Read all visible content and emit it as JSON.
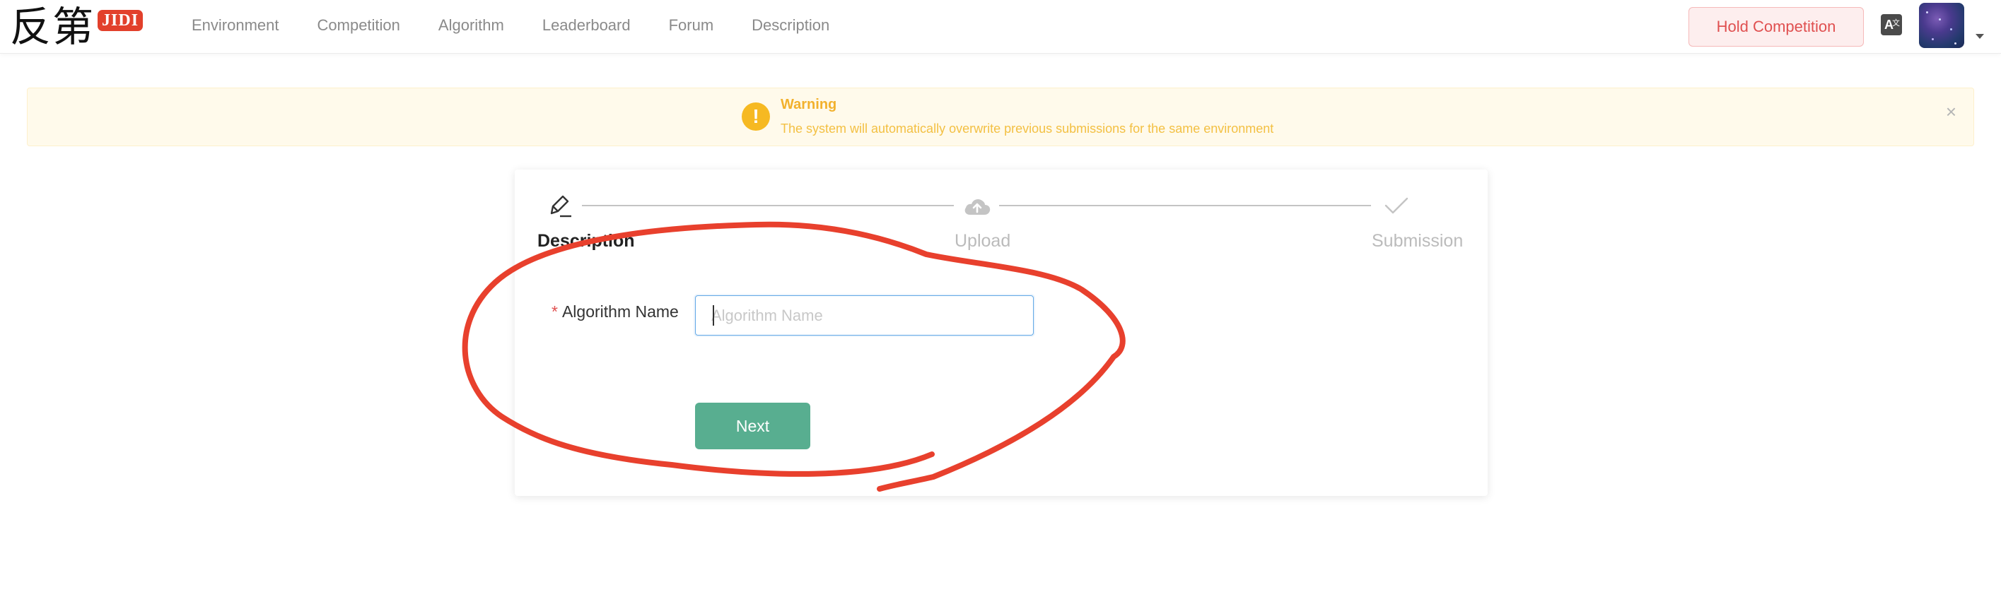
{
  "header": {
    "logo_cn": "反第",
    "logo_badge": "JIDI",
    "nav": [
      "Environment",
      "Competition",
      "Algorithm",
      "Leaderboard",
      "Forum",
      "Description"
    ],
    "hold_button": "Hold Competition",
    "lang_icon_glyph": "A",
    "lang_icon_small": "文"
  },
  "warning": {
    "title": "Warning",
    "text": "The system will automatically overwrite previous submissions for the same environment",
    "close_glyph": "×",
    "icon_glyph": "!"
  },
  "steps": [
    {
      "label": "Description",
      "icon": "pencil-icon",
      "status": "active"
    },
    {
      "label": "Upload",
      "icon": "cloud-upload-icon",
      "status": "inactive"
    },
    {
      "label": "Submission",
      "icon": "check-icon",
      "status": "inactive"
    }
  ],
  "form": {
    "required_mark": "*",
    "label": "Algorithm Name",
    "placeholder": "Algorithm Name",
    "value": ""
  },
  "next_button": "Next",
  "colors": {
    "accent_green": "#58ae90",
    "hold_red": "#e05050",
    "warning_yellow": "#f6b922",
    "annotation_red": "#e8402d"
  }
}
